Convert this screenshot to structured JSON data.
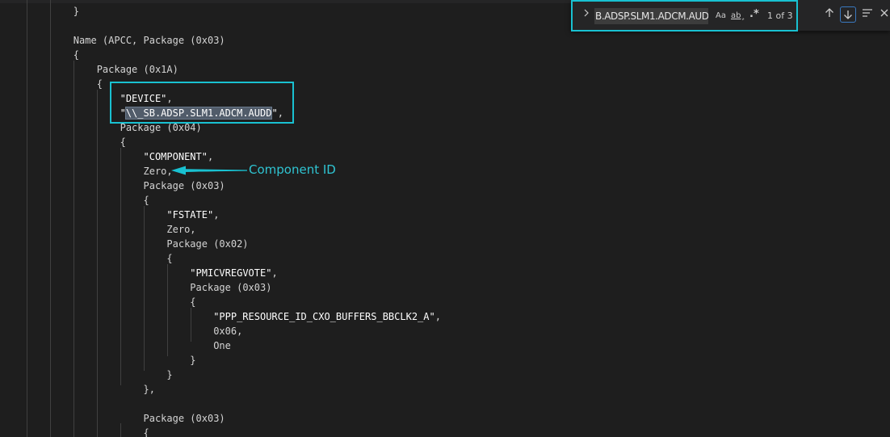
{
  "code": {
    "lines": [
      {
        "indent": "        ",
        "parts": [
          {
            "t": "}",
            "c": "p"
          }
        ]
      },
      {
        "indent": "",
        "parts": []
      },
      {
        "indent": "        ",
        "parts": [
          {
            "t": "Name (APCC, Package (0x03)",
            "c": "p"
          }
        ]
      },
      {
        "indent": "        ",
        "parts": [
          {
            "t": "{",
            "c": "p"
          }
        ]
      },
      {
        "indent": "            ",
        "parts": [
          {
            "t": "Package (0x1A)",
            "c": "p"
          }
        ]
      },
      {
        "indent": "            ",
        "parts": [
          {
            "t": "{",
            "c": "p"
          }
        ]
      },
      {
        "indent": "                ",
        "parts": [
          {
            "t": "\"DEVICE\"",
            "c": "s"
          },
          {
            "t": ",",
            "c": "p"
          }
        ]
      },
      {
        "indent": "                ",
        "parts": [
          {
            "t": "\"",
            "c": "s"
          },
          {
            "t": "\\\\_SB.ADSP.SLM1.ADCM.AUDD",
            "c": "m"
          },
          {
            "t": "\"",
            "c": "s"
          },
          {
            "t": ",",
            "c": "p"
          }
        ]
      },
      {
        "indent": "                ",
        "parts": [
          {
            "t": "Package (0x04)",
            "c": "p"
          }
        ]
      },
      {
        "indent": "                ",
        "parts": [
          {
            "t": "{",
            "c": "p"
          }
        ]
      },
      {
        "indent": "                    ",
        "parts": [
          {
            "t": "\"COMPONENT\"",
            "c": "s"
          },
          {
            "t": ",",
            "c": "p"
          }
        ]
      },
      {
        "indent": "                    ",
        "parts": [
          {
            "t": "Zero,",
            "c": "p"
          }
        ]
      },
      {
        "indent": "                    ",
        "parts": [
          {
            "t": "Package (0x03)",
            "c": "p"
          }
        ]
      },
      {
        "indent": "                    ",
        "parts": [
          {
            "t": "{",
            "c": "p"
          }
        ]
      },
      {
        "indent": "                        ",
        "parts": [
          {
            "t": "\"FSTATE\"",
            "c": "s"
          },
          {
            "t": ",",
            "c": "p"
          }
        ]
      },
      {
        "indent": "                        ",
        "parts": [
          {
            "t": "Zero,",
            "c": "p"
          }
        ]
      },
      {
        "indent": "                        ",
        "parts": [
          {
            "t": "Package (0x02)",
            "c": "p"
          }
        ]
      },
      {
        "indent": "                        ",
        "parts": [
          {
            "t": "{",
            "c": "p"
          }
        ]
      },
      {
        "indent": "                            ",
        "parts": [
          {
            "t": "\"PMICVREGVOTE\"",
            "c": "s"
          },
          {
            "t": ",",
            "c": "p"
          }
        ]
      },
      {
        "indent": "                            ",
        "parts": [
          {
            "t": "Package (0x03)",
            "c": "p"
          }
        ]
      },
      {
        "indent": "                            ",
        "parts": [
          {
            "t": "{",
            "c": "p"
          }
        ]
      },
      {
        "indent": "                                ",
        "parts": [
          {
            "t": "\"PPP_RESOURCE_ID_CXO_BUFFERS_BBCLK2_A\"",
            "c": "s"
          },
          {
            "t": ",",
            "c": "p"
          }
        ]
      },
      {
        "indent": "                                ",
        "parts": [
          {
            "t": "0x06,",
            "c": "p"
          }
        ]
      },
      {
        "indent": "                                ",
        "parts": [
          {
            "t": "One",
            "c": "p"
          }
        ]
      },
      {
        "indent": "                            ",
        "parts": [
          {
            "t": "}",
            "c": "p"
          }
        ]
      },
      {
        "indent": "                        ",
        "parts": [
          {
            "t": "}",
            "c": "p"
          }
        ]
      },
      {
        "indent": "                    ",
        "parts": [
          {
            "t": "},",
            "c": "p"
          }
        ]
      },
      {
        "indent": "",
        "parts": []
      },
      {
        "indent": "                    ",
        "parts": [
          {
            "t": "Package (0x03)",
            "c": "p"
          }
        ]
      },
      {
        "indent": "                    ",
        "parts": [
          {
            "t": "{",
            "c": "p"
          }
        ]
      }
    ]
  },
  "annotation": {
    "label": "Component ID"
  },
  "find_widget": {
    "toggle_icon": "chevron-right",
    "query": "B.ADSP.SLM1.ADCM.AUDD",
    "match_case_label": "Aa",
    "whole_word_label": "ab",
    "regex_label": ".*",
    "match_count": "1 of 3",
    "prev_icon": "arrow-up",
    "next_icon": "arrow-down",
    "selection_icon": "find-in-selection",
    "close_icon": "close"
  },
  "colors": {
    "background": "#1e1e1e",
    "text": "#d4d4d4",
    "annotation": "#19c1d1",
    "match_highlight": "#515c6a"
  }
}
